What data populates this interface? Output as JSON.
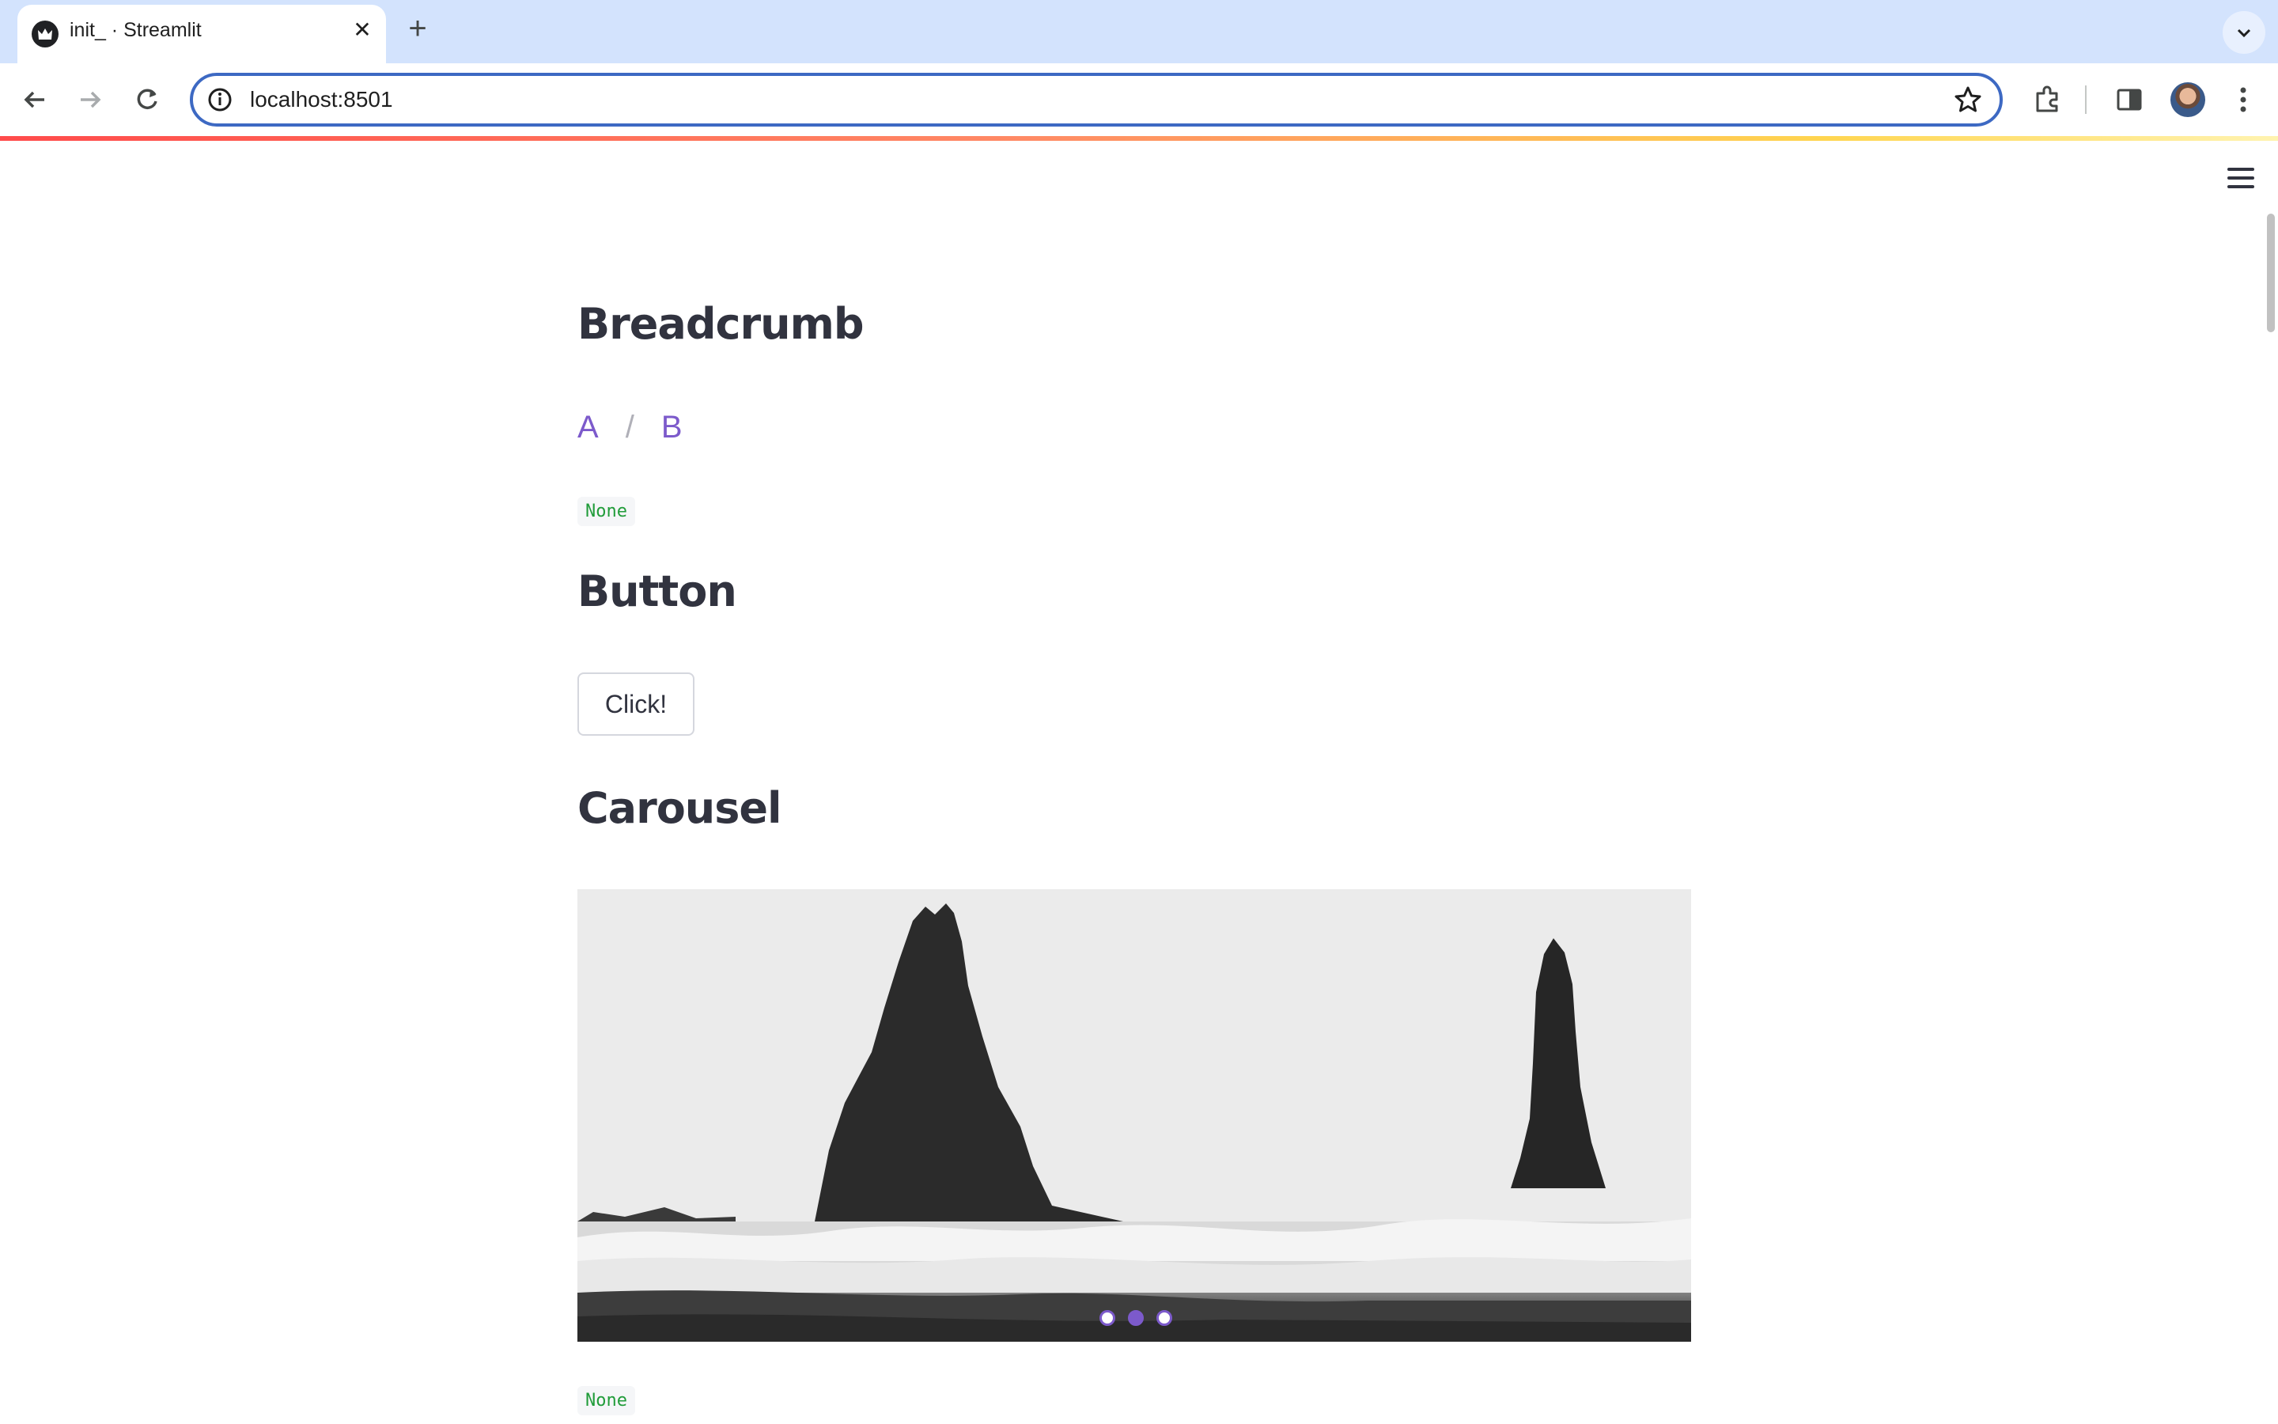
{
  "browser": {
    "tab_title": "init_ · Streamlit",
    "url": "localhost:8501",
    "icons": {
      "back": "arrow-left-icon",
      "forward": "arrow-right-icon",
      "reload": "reload-icon",
      "info": "info-icon",
      "star": "star-icon",
      "extensions": "puzzle-icon",
      "sidepanel": "side-panel-icon",
      "menu": "kebab-menu-icon"
    }
  },
  "app": {
    "sections": {
      "breadcrumb": {
        "title": "Breadcrumb",
        "items": [
          "A",
          "B"
        ],
        "separator": "/",
        "output": "None"
      },
      "button": {
        "title": "Button",
        "label": "Click!"
      },
      "carousel": {
        "title": "Carousel",
        "slide_count": 3,
        "active_slide": 2,
        "output": "None"
      }
    }
  },
  "colors": {
    "accent": "#7c5acb",
    "code_text": "#219c3a",
    "heading": "#31333f"
  }
}
